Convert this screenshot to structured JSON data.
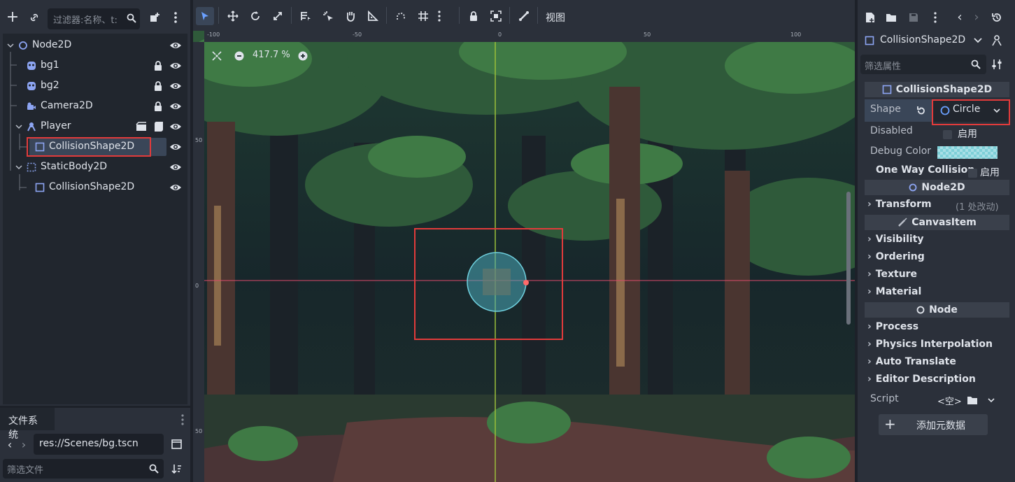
{
  "scene_dock": {
    "filter_placeholder": "过滤器:名称、t:",
    "nodes": [
      {
        "label": "Node2D",
        "type": "node2d"
      },
      {
        "label": "bg1",
        "type": "sprite"
      },
      {
        "label": "bg2",
        "type": "sprite"
      },
      {
        "label": "Camera2D",
        "type": "camera"
      },
      {
        "label": "Player",
        "type": "character"
      },
      {
        "label": "CollisionShape2D",
        "type": "collision"
      },
      {
        "label": "StaticBody2D",
        "type": "staticbody"
      },
      {
        "label": "CollisionShape2D",
        "type": "collision"
      }
    ]
  },
  "filesystem": {
    "tab_label": "文件系统",
    "path": "res://Scenes/bg.tscn",
    "filter_placeholder": "筛选文件"
  },
  "toolbar": {
    "view_label": "视图"
  },
  "viewport": {
    "zoom": "417.7 %",
    "ruler_h": [
      "-100",
      "-50",
      "0",
      "50",
      "100"
    ],
    "ruler_v": [
      "50",
      "0",
      "50"
    ]
  },
  "inspector": {
    "node_select": "CollisionShape2D",
    "filter_placeholder": "筛选属性",
    "header": "CollisionShape2D",
    "shape_label": "Shape",
    "shape_value": "Circle",
    "disabled_label": "Disabled",
    "disabled_value": "启用",
    "debug_color_label": "Debug Color",
    "one_way_label": "One Way Collision",
    "one_way_value": "启用",
    "node2d_header": "Node2D",
    "transform_label": "Transform",
    "transform_note": "(1 处改动)",
    "canvasitem_header": "CanvasItem",
    "canvas_cats": [
      "Visibility",
      "Ordering",
      "Texture",
      "Material"
    ],
    "node_header": "Node",
    "node_cats": [
      "Process",
      "Physics Interpolation",
      "Auto Translate",
      "Editor Description"
    ],
    "script_label": "Script",
    "script_value": "<空>",
    "add_metadata": "添加元数据"
  },
  "colors": {
    "accent": "#6aa0ff",
    "highlight": "#e23b3b",
    "selection": "#3a4658"
  }
}
